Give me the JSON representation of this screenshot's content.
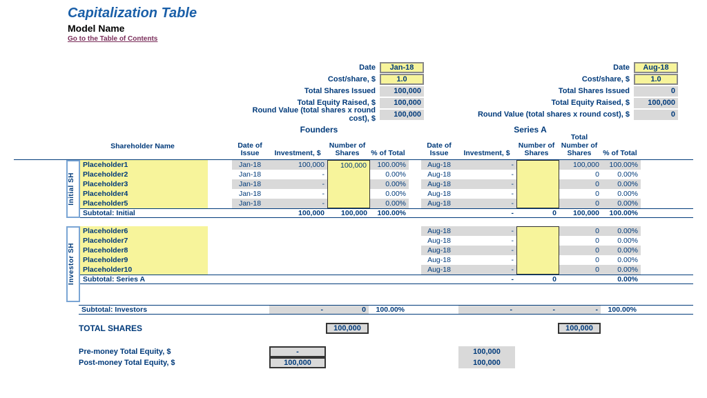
{
  "header": {
    "title": "Capitalization Table",
    "subtitle": "Model Name",
    "toc": "Go to the Table of Contents"
  },
  "round_labels": {
    "date": "Date",
    "cost": "Cost/share, $",
    "shares_issued": "Total Shares Issued",
    "equity_raised": "Total Equity Raised, $",
    "round_value": "Round Value (total shares x round cost), $"
  },
  "founders": {
    "title": "Founders",
    "date": "Jan-18",
    "cost": "1.0",
    "shares_issued": "100,000",
    "equity_raised": "100,000",
    "round_value": "100,000",
    "head": {
      "date": "Date of Issue",
      "invest": "Investment, $",
      "shares": "Number of Shares",
      "pct": "% of Total"
    }
  },
  "seriesA": {
    "title": "Series A",
    "date": "Aug-18",
    "cost": "1.0",
    "shares_issued": "0",
    "equity_raised": "100,000",
    "round_value": "0",
    "head": {
      "date": "Date of Issue",
      "invest": "Investment, $",
      "shares": "Number of Shares",
      "total": "Total Number of Shares",
      "pct": "% of Total"
    }
  },
  "labels": {
    "shareholder": "Shareholder Name",
    "initial_v": "Initial SH",
    "investor_v": "Investor SH",
    "subtotal_initial": "Subtotal: Initial",
    "subtotal_seriesA": "Subtotal: Series A",
    "subtotal_investors": "Subtotal: Investors",
    "total_shares": "TOTAL SHARES",
    "pre_money": "Pre-money Total Equity, $",
    "post_money": "Post-money Total Equity, $"
  },
  "initial": [
    {
      "name": "Placeholder1",
      "f_date": "Jan-18",
      "f_inv": "100,000",
      "f_sh": "100,000",
      "f_pct": "100.00%",
      "a_date": "Aug-18",
      "a_inv": "-",
      "a_sh": "",
      "a_total": "100,000",
      "a_pct": "100.00%"
    },
    {
      "name": "Placeholder2",
      "f_date": "Jan-18",
      "f_inv": "-",
      "f_sh": "",
      "f_pct": "0.00%",
      "a_date": "Aug-18",
      "a_inv": "-",
      "a_sh": "",
      "a_total": "0",
      "a_pct": "0.00%"
    },
    {
      "name": "Placeholder3",
      "f_date": "Jan-18",
      "f_inv": "-",
      "f_sh": "",
      "f_pct": "0.00%",
      "a_date": "Aug-18",
      "a_inv": "-",
      "a_sh": "",
      "a_total": "0",
      "a_pct": "0.00%"
    },
    {
      "name": "Placeholder4",
      "f_date": "Jan-18",
      "f_inv": "-",
      "f_sh": "",
      "f_pct": "0.00%",
      "a_date": "Aug-18",
      "a_inv": "-",
      "a_sh": "",
      "a_total": "0",
      "a_pct": "0.00%"
    },
    {
      "name": "Placeholder5",
      "f_date": "Jan-18",
      "f_inv": "-",
      "f_sh": "",
      "f_pct": "0.00%",
      "a_date": "Aug-18",
      "a_inv": "-",
      "a_sh": "",
      "a_total": "0",
      "a_pct": "0.00%"
    }
  ],
  "subtotal_initial_vals": {
    "f_inv": "100,000",
    "f_sh": "100,000",
    "f_pct": "100.00%",
    "a_inv": "-",
    "a_sh": "0",
    "a_total": "100,000",
    "a_pct": "100.00%"
  },
  "investors": [
    {
      "name": "Placeholder6",
      "a_date": "Aug-18",
      "a_inv": "-",
      "a_sh": "",
      "a_total": "0",
      "a_pct": "0.00%"
    },
    {
      "name": "Placeholder7",
      "a_date": "Aug-18",
      "a_inv": "-",
      "a_sh": "",
      "a_total": "0",
      "a_pct": "0.00%"
    },
    {
      "name": "Placeholder8",
      "a_date": "Aug-18",
      "a_inv": "-",
      "a_sh": "",
      "a_total": "0",
      "a_pct": "0.00%"
    },
    {
      "name": "Placeholder9",
      "a_date": "Aug-18",
      "a_inv": "-",
      "a_sh": "",
      "a_total": "0",
      "a_pct": "0.00%"
    },
    {
      "name": "Placeholder10",
      "a_date": "Aug-18",
      "a_inv": "-",
      "a_sh": "",
      "a_total": "0",
      "a_pct": "0.00%"
    }
  ],
  "subtotal_seriesA_vals": {
    "a_inv": "-",
    "a_sh": "0",
    "a_total": "",
    "a_pct": "0.00%"
  },
  "subtotal_investors_vals": {
    "f_inv": "-",
    "f_sh": "0",
    "f_pct": "100.00%",
    "a_inv": "-",
    "a_sh": "-",
    "a_total": "-",
    "a_pct": "100.00%"
  },
  "total_shares_vals": {
    "f": "100,000",
    "a": "100,000"
  },
  "equity": {
    "pre_f": "-",
    "post_f": "100,000",
    "pre_a": "100,000",
    "post_a": "100,000"
  }
}
